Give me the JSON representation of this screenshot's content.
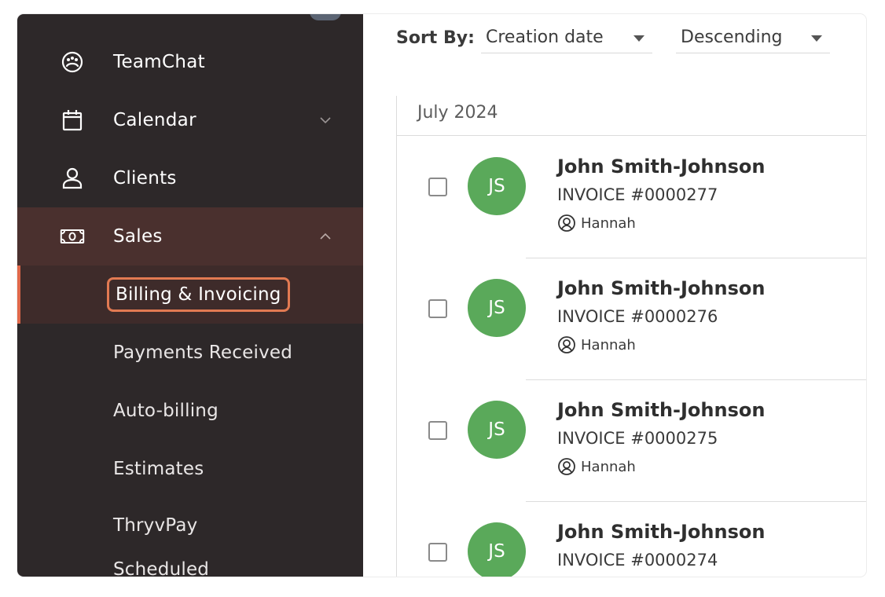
{
  "sidebar": {
    "items": [
      {
        "label": "TeamChat",
        "icon": "team-chat-icon"
      },
      {
        "label": "Calendar",
        "icon": "calendar-icon",
        "chevron": "chevron-down-icon"
      },
      {
        "label": "Clients",
        "icon": "person-icon"
      },
      {
        "label": "Sales",
        "icon": "cash-icon",
        "chevron": "chevron-up-icon"
      }
    ],
    "sub_items": [
      {
        "label": "Billing & Invoicing",
        "active": true
      },
      {
        "label": "Payments Received"
      },
      {
        "label": "Auto-billing"
      },
      {
        "label": "Estimates"
      },
      {
        "label": "ThryvPay"
      },
      {
        "label": "Scheduled"
      }
    ]
  },
  "sort": {
    "label": "Sort By:",
    "field_value": "Creation date",
    "order_value": "Descending"
  },
  "list": {
    "month": "July 2024",
    "rows": [
      {
        "initials": "JS",
        "name": "John Smith-Johnson",
        "invoice": "INVOICE #0000277",
        "owner": "Hannah"
      },
      {
        "initials": "JS",
        "name": "John Smith-Johnson",
        "invoice": "INVOICE #0000276",
        "owner": "Hannah"
      },
      {
        "initials": "JS",
        "name": "John Smith-Johnson",
        "invoice": "INVOICE #0000275",
        "owner": "Hannah"
      },
      {
        "initials": "JS",
        "name": "John Smith-Johnson",
        "invoice": "INVOICE #0000274",
        "owner": ""
      }
    ]
  },
  "colors": {
    "sidebar_bg": "#2d2829",
    "sales_bg": "#4a302e",
    "accent": "#e0684a",
    "avatar": "#5aa95a"
  }
}
